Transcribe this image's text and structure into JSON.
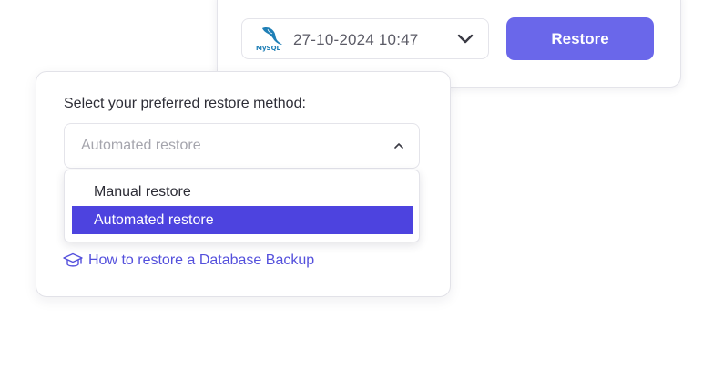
{
  "backup": {
    "selected_date": "27-10-2024 10:47",
    "db_icon": "mysql-logo",
    "db_logo_text": "MySQL",
    "chevron_icon": "chevron-down-icon",
    "restore_label": "Restore"
  },
  "restore_method": {
    "label": "Select your preferred restore method:",
    "selected_value": "Automated restore",
    "chevron_icon": "chevron-up-icon",
    "options": [
      {
        "label": "Manual restore",
        "highlighted": false
      },
      {
        "label": "Automated restore",
        "highlighted": true
      }
    ]
  },
  "help": {
    "icon": "graduation-cap-icon",
    "link_text": "How to restore a Database Backup"
  },
  "colors": {
    "accent": "#6a67ea",
    "highlight": "#4d43df",
    "link": "#5450dc"
  }
}
